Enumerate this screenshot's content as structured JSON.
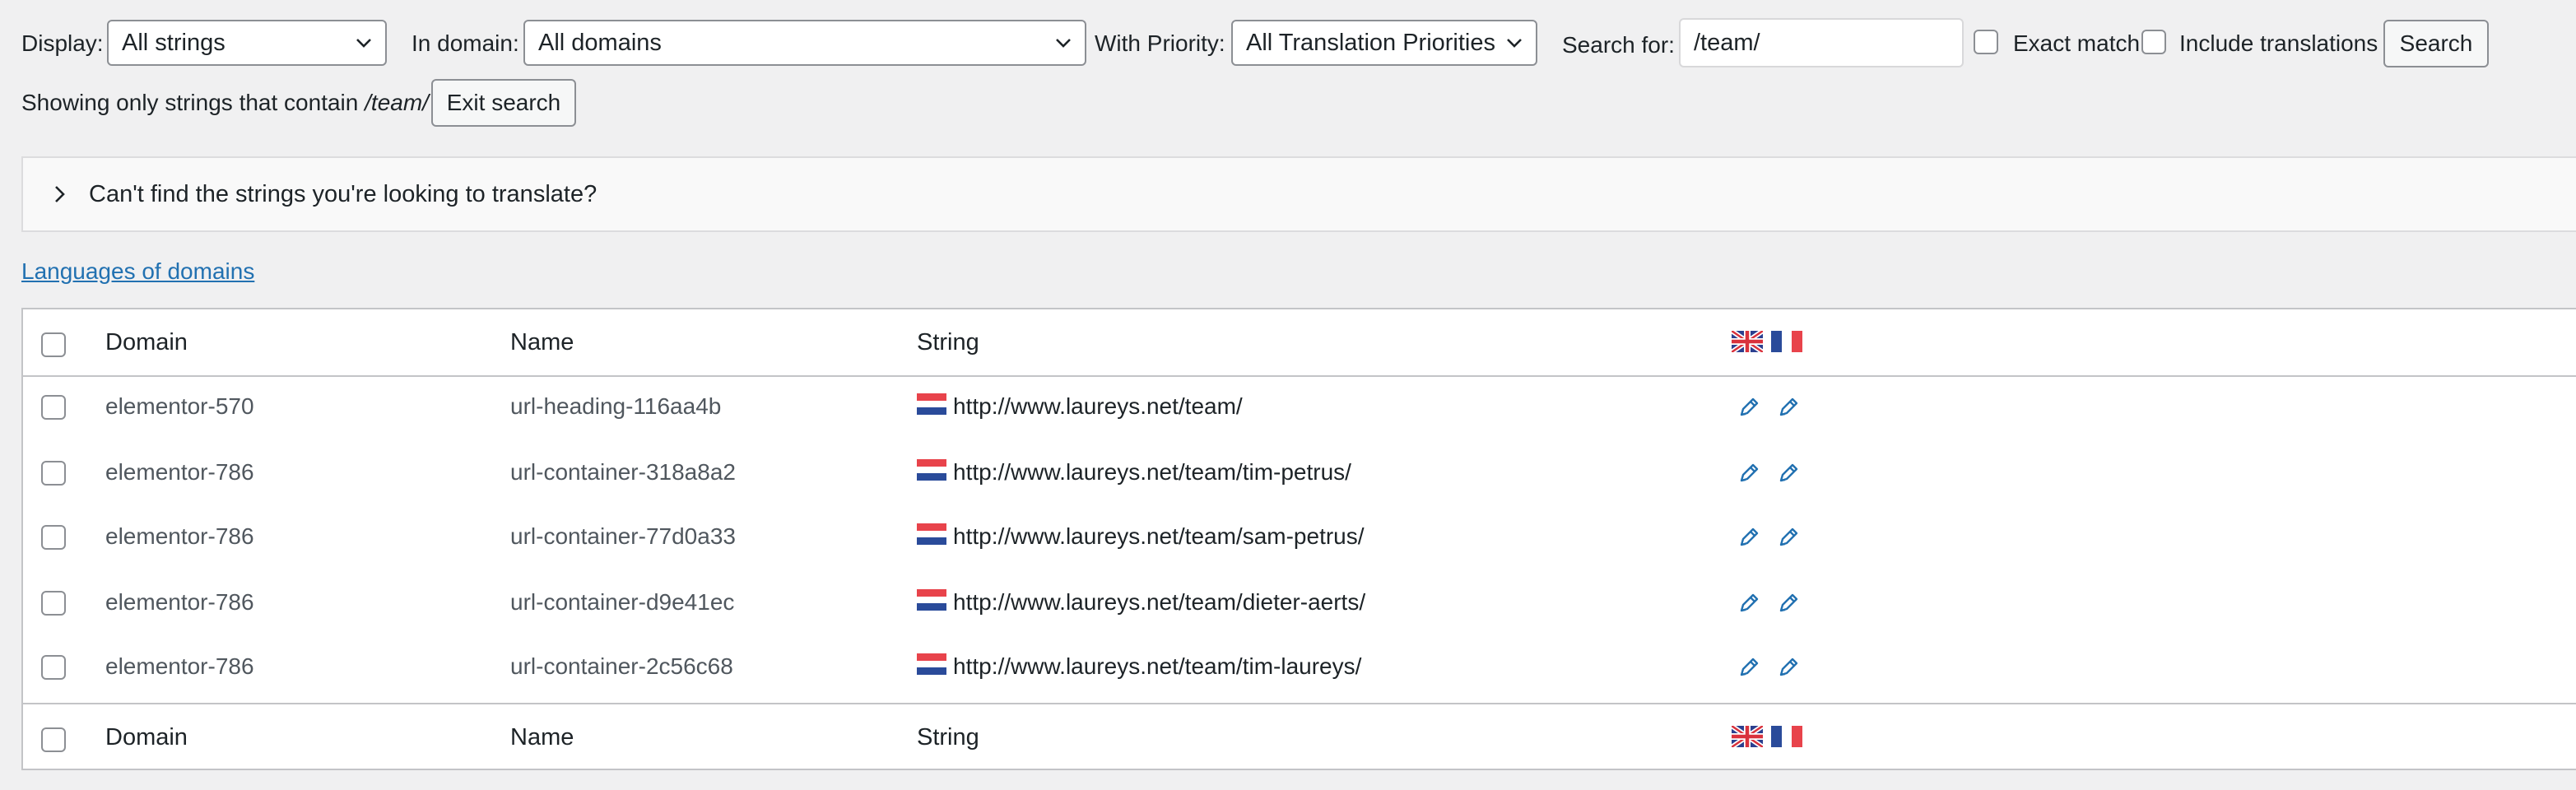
{
  "filters": {
    "display_label": "Display:",
    "display_value": "All strings",
    "domain_label": "In domain:",
    "domain_value": "All domains",
    "priority_label": "With Priority:",
    "priority_value": "All Translation Priorities",
    "search_label": "Search for:",
    "search_value": "/team/",
    "exact_match_label": "Exact match",
    "include_translations_label": "Include translations",
    "search_button": "Search"
  },
  "search_notice": {
    "prefix": "Showing only strings that contain",
    "term": "/team/",
    "exit_button": "Exit search"
  },
  "help_panel": {
    "text": "Can't find the strings you're looking to translate?"
  },
  "languages_link": "Languages of domains",
  "table": {
    "columns": [
      "Domain",
      "Name",
      "String"
    ],
    "language_flags": [
      "english-uk-flag-icon",
      "french-flag-icon"
    ],
    "rows": [
      {
        "domain": "elementor-570",
        "name": "url-heading-116aa4b",
        "string": "http://www.laureys.net/team/"
      },
      {
        "domain": "elementor-786",
        "name": "url-container-318a8a2",
        "string": "http://www.laureys.net/team/tim-petrus/"
      },
      {
        "domain": "elementor-786",
        "name": "url-container-77d0a33",
        "string": "http://www.laureys.net/team/sam-petrus/"
      },
      {
        "domain": "elementor-786",
        "name": "url-container-d9e41ec",
        "string": "http://www.laureys.net/team/dieter-aerts/"
      },
      {
        "domain": "elementor-786",
        "name": "url-container-2c56c68",
        "string": "http://www.laureys.net/team/tim-laureys/"
      }
    ]
  },
  "colors": {
    "link": "#2271b1",
    "pencil": "#2271b1",
    "page_bg": "#f0f0f1"
  }
}
